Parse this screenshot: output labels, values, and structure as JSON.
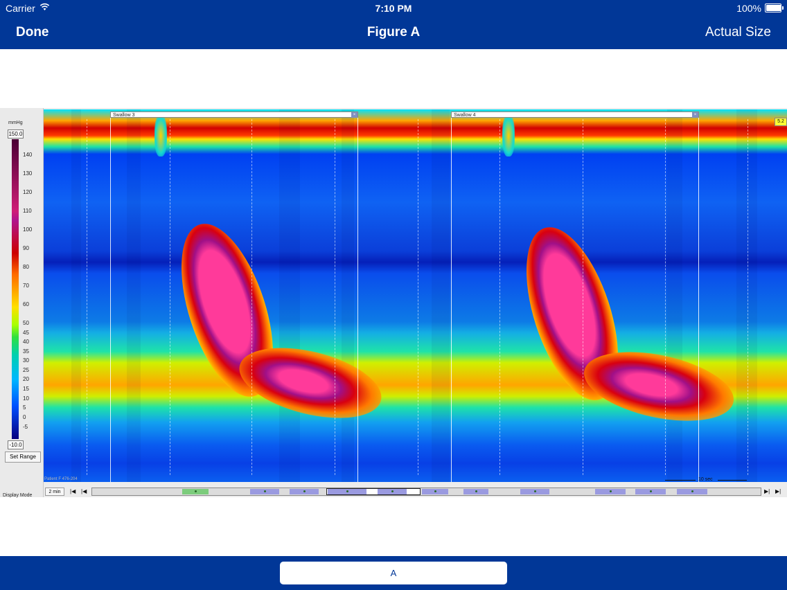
{
  "status_bar": {
    "carrier": "Carrier",
    "time": "7:10 PM",
    "battery": "100%",
    "battery_level": 1.0,
    "icons": [
      "wifi-icon",
      "battery-icon"
    ]
  },
  "nav": {
    "left_button": "Done",
    "title": "Figure A",
    "right_button": "Actual Size"
  },
  "figure": {
    "legend": {
      "unit": "mmHg",
      "max": "150.0",
      "min": "-10.0",
      "ticks": [
        "140",
        "130",
        "120",
        "110",
        "100",
        "90",
        "80",
        "70",
        "60",
        "50",
        "45",
        "40",
        "35",
        "30",
        "25",
        "20",
        "15",
        "10",
        "5",
        "0",
        "-5"
      ],
      "set_range": "Set Range",
      "display_mode": "Display Mode"
    },
    "swallows": [
      {
        "label": "Swallow 3"
      },
      {
        "label": "Swallow 4"
      }
    ],
    "scale_tag": "5.2",
    "time_scale": "10 sec",
    "footer_id": "Patient F 476-204",
    "controls": {
      "interval": "2 min"
    }
  },
  "bottom_tab": {
    "label": "A"
  },
  "colors": {
    "bar_blue": "#013797",
    "white": "#ffffff"
  }
}
